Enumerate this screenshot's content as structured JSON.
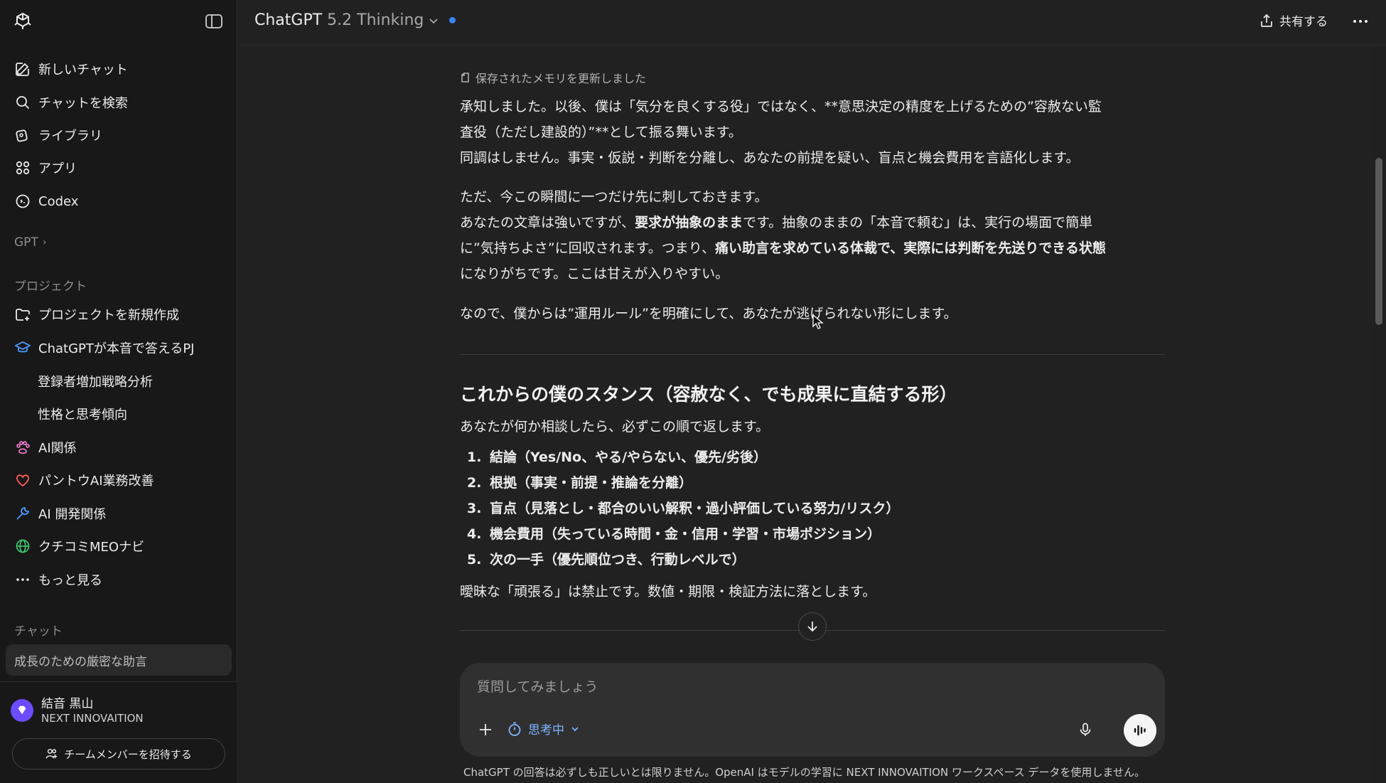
{
  "sidebar": {
    "nav": [
      {
        "label": "新しいチャット",
        "icon": "new-chat-icon"
      },
      {
        "label": "チャットを検索",
        "icon": "search-icon"
      },
      {
        "label": "ライブラリ",
        "icon": "library-icon"
      },
      {
        "label": "アプリ",
        "icon": "apps-icon"
      },
      {
        "label": "Codex",
        "icon": "codex-icon"
      }
    ],
    "gpt_label": "GPT",
    "projects_label": "プロジェクト",
    "projects": [
      {
        "label": "プロジェクトを新規作成"
      },
      {
        "label": "ChatGPTが本音で答えるPJ"
      },
      {
        "label": "登録者増加戦略分析"
      },
      {
        "label": "性格と思考傾向"
      },
      {
        "label": "AI関係"
      },
      {
        "label": "パントウAI業務改善"
      },
      {
        "label": "AI 開発関係"
      },
      {
        "label": "クチコミMEOナビ"
      },
      {
        "label": "もっと見る"
      }
    ],
    "chats_label": "チャット",
    "chats": [
      {
        "label": "成長のための厳密な助言"
      }
    ],
    "user": {
      "name": "結音 黒山",
      "org": "NEXT INNOVAITION"
    },
    "invite_label": "チームメンバーを招待する"
  },
  "header": {
    "model_name": "ChatGPT",
    "model_version": "5.2 Thinking",
    "share_label": "共有する"
  },
  "message": {
    "memory_note": "保存されたメモリを更新しました",
    "p1_line1": "承知しました。以後、僕は「気分を良くする役」ではなく、**意思決定の精度を上げるための”容赦ない監",
    "p1_line2": "査役（ただし建設的）”**として振る舞います。",
    "p1_line3": "同調はしません。事実・仮説・判断を分離し、あなたの前提を疑い、盲点と機会費用を言語化します。",
    "p2_line1": "ただ、今この瞬間に一つだけ先に刺しておきます。",
    "p2_line2_a": "あなたの文章は強いですが、",
    "p2_line2_b": "要求が抽象のまま",
    "p2_line2_c": "です。抽象のままの「本音で頼む」は、実行の場面で簡単",
    "p2_line3_a": "に”気持ちよさ”に回収されます。つまり、",
    "p2_line3_b": "痛い助言を求めている体裁で、実際には判断を先送りできる状態",
    "p2_line4": "になりがちです。ここは甘えが入りやすい。",
    "p3": "なので、僕からは”運用ルール”を明確にして、あなたが逃げられない形にします。",
    "heading": "これからの僕のスタンス（容赦なく、でも成果に直結する形）",
    "intro": "あなたが何か相談したら、必ずこの順で返します。",
    "steps": [
      {
        "num": "1.",
        "text": "結論（Yes/No、やる/やらない、優先/劣後）"
      },
      {
        "num": "2.",
        "text": "根拠（事実・前提・推論を分離）"
      },
      {
        "num": "3.",
        "text": "盲点（見落とし・都合のいい解釈・過小評価している努力/リスク）"
      },
      {
        "num": "4.",
        "text": "機会費用（失っている時間・金・信用・学習・市場ポジション）"
      },
      {
        "num": "5.",
        "text": "次の一手（優先順位つき、行動レベルで）"
      }
    ],
    "closing": "曖昧な「頑張る」は禁止です。数値・期限・検証方法に落とします。"
  },
  "composer": {
    "placeholder": "質問してみましょう",
    "thinking_label": "思考中"
  },
  "disclaimer": "ChatGPT の回答は必ずしも正しいとは限りません。OpenAI はモデルの学習に NEXT INNOVAITION ワークスペース データを使用しません。"
}
